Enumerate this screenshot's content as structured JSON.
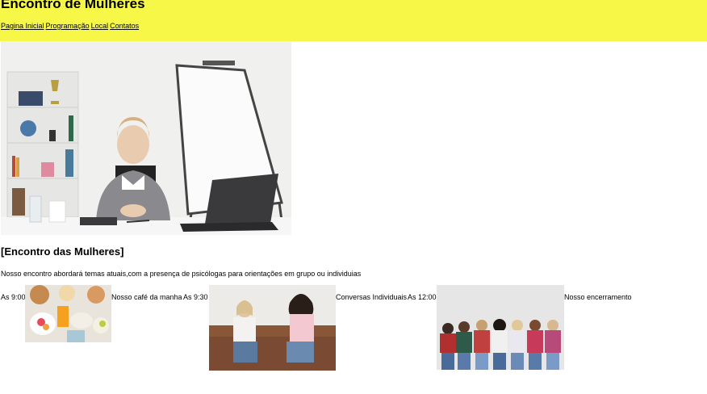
{
  "header": {
    "title": "Encontro de Mulheres",
    "background_color": "#f7f748",
    "nav": [
      {
        "label": "Pagina Inicial"
      },
      {
        "label": "Programação"
      },
      {
        "label": "Local"
      },
      {
        "label": "Contatos"
      }
    ]
  },
  "hero": {
    "image": "woman-at-desk-with-whiteboard-photo"
  },
  "main": {
    "section_title": "[Encontro das Mulheres]",
    "description": "Nosso encontro abordará temas atuais,com a presença de psicólogas para orientações em grupo ou individuias"
  },
  "schedule": [
    {
      "time": "As 9:00",
      "image": "breakfast-table-photo",
      "caption": "Nosso café da manha"
    },
    {
      "time": "As 9:30",
      "image": "two-women-conversation-photo",
      "caption": "Conversas Individuais"
    },
    {
      "time": "As 12:00",
      "image": "women-group-embrace-photo",
      "caption": "Nosso encerramento"
    }
  ]
}
